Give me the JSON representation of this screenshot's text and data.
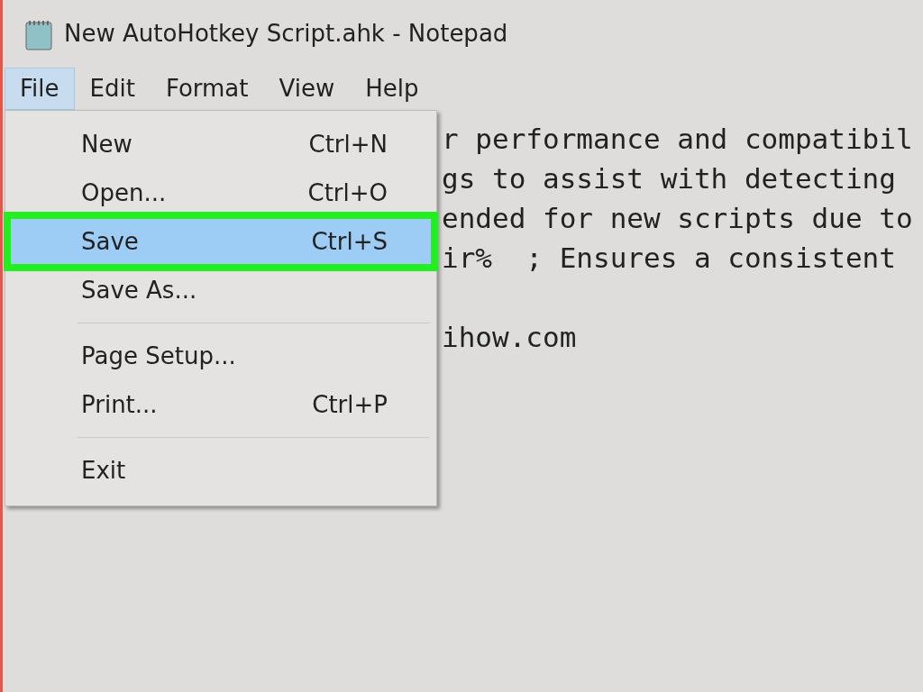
{
  "window": {
    "title": "New AutoHotkey Script.ahk - Notepad"
  },
  "menubar": [
    {
      "label": "File",
      "selected": true
    },
    {
      "label": "Edit",
      "selected": false
    },
    {
      "label": "Format",
      "selected": false
    },
    {
      "label": "View",
      "selected": false
    },
    {
      "label": "Help",
      "selected": false
    }
  ],
  "editor_lines": [
    "r performance and compatibil",
    "gs to assist with detecting",
    "ended for new scripts due to",
    "ir%  ; Ensures a consistent",
    "ihow.com"
  ],
  "file_menu": [
    {
      "kind": "item",
      "label": "New",
      "shortcut": "Ctrl+N",
      "selected": false
    },
    {
      "kind": "item",
      "label": "Open...",
      "shortcut": "Ctrl+O",
      "selected": false
    },
    {
      "kind": "item",
      "label": "Save",
      "shortcut": "Ctrl+S",
      "selected": true
    },
    {
      "kind": "item",
      "label": "Save As...",
      "selected": false
    },
    {
      "kind": "separator"
    },
    {
      "kind": "item",
      "label": "Page Setup...",
      "selected": false
    },
    {
      "kind": "item",
      "label": "Print...",
      "shortcut": "Ctrl+P",
      "selected": false
    },
    {
      "kind": "separator"
    },
    {
      "kind": "item",
      "label": "Exit",
      "selected": false
    }
  ]
}
